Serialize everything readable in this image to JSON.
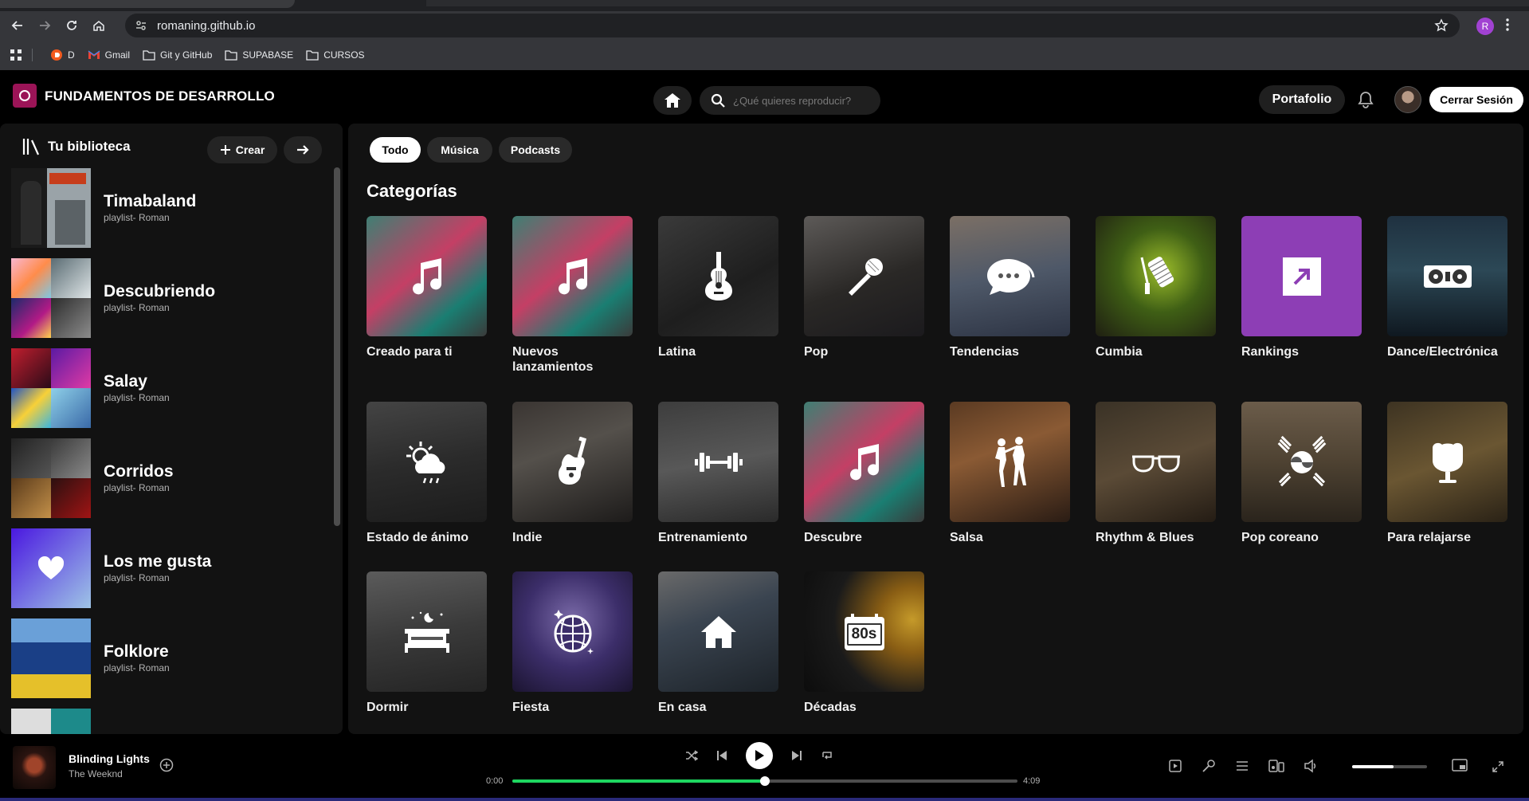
{
  "browser": {
    "url": "romaning.github.io",
    "profile_initial": "R",
    "bookmarks": [
      {
        "label": "D",
        "icon": "brave-favicon-icon"
      },
      {
        "label": "Gmail",
        "icon": "gmail-icon"
      },
      {
        "label": "Git y GitHub",
        "icon": "folder-icon"
      },
      {
        "label": "SUPABASE",
        "icon": "folder-icon"
      },
      {
        "label": "CURSOS",
        "icon": "folder-icon"
      }
    ]
  },
  "header": {
    "title": "FUNDAMENTOS DE DESARROLLO",
    "search_placeholder": "¿Qué quieres reproducir?",
    "portfolio_label": "Portafolio",
    "logout_label": "Cerrar Sesión"
  },
  "sidebar": {
    "title": "Tu biblioteca",
    "create_label": "Crear",
    "playlists": [
      {
        "name": "Timabaland",
        "sub": "playlist- Roman"
      },
      {
        "name": "Descubriendo",
        "sub": "playlist- Roman"
      },
      {
        "name": "Salay",
        "sub": "playlist- Roman"
      },
      {
        "name": "Corridos",
        "sub": "playlist- Roman"
      },
      {
        "name": "Los me gusta",
        "sub": "playlist- Roman"
      },
      {
        "name": "Folklore",
        "sub": "playlist- Roman"
      }
    ]
  },
  "main": {
    "filters": [
      "Todo",
      "Música",
      "Podcasts"
    ],
    "active_filter": "Todo",
    "section_title": "Categorías",
    "categories": [
      {
        "label": "Creado para ti",
        "icon": "music-note-icon"
      },
      {
        "label": "Nuevos lanzamientos",
        "icon": "music-note-icon"
      },
      {
        "label": "Latina",
        "icon": "guitar-icon"
      },
      {
        "label": "Pop",
        "icon": "microphone-icon"
      },
      {
        "label": "Tendencias",
        "icon": "chat-bubble-icon"
      },
      {
        "label": "Cumbia",
        "icon": "guiro-icon"
      },
      {
        "label": "Rankings",
        "icon": "trending-arrow-icon"
      },
      {
        "label": "Dance/Electrónica",
        "icon": "turntable-icon"
      },
      {
        "label": "Estado de ánimo",
        "icon": "weather-icon"
      },
      {
        "label": "Indie",
        "icon": "electric-guitar-icon"
      },
      {
        "label": "Entrenamiento",
        "icon": "dumbbell-icon"
      },
      {
        "label": "Descubre",
        "icon": "music-note-icon"
      },
      {
        "label": "Salsa",
        "icon": "dancers-icon"
      },
      {
        "label": "Rhythm & Blues",
        "icon": "sunglasses-icon"
      },
      {
        "label": "Pop coreano",
        "icon": "taegeuk-icon"
      },
      {
        "label": "Para relajarse",
        "icon": "egg-chair-icon"
      },
      {
        "label": "Dormir",
        "icon": "bed-icon"
      },
      {
        "label": "Fiesta",
        "icon": "disco-ball-icon"
      },
      {
        "label": "En casa",
        "icon": "house-icon"
      },
      {
        "label": "Décadas",
        "icon": "80s-calendar-icon"
      }
    ]
  },
  "player": {
    "track_title": "Blinding Lights",
    "track_artist": "The Weeknd",
    "time_current": "0:00",
    "time_total": "4:09",
    "progress_fraction": 0.5,
    "volume_fraction": 0.55
  },
  "colors": {
    "accent_green": "#1ed760",
    "rankings_purple": "#8d3eb5",
    "logo_magenta": "#9b1457"
  }
}
